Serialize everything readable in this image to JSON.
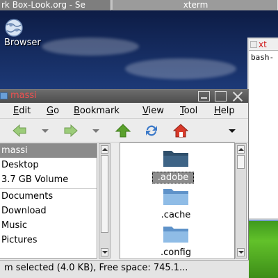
{
  "taskbar": {
    "tasks": [
      {
        "label": "rk Box-Look.org - Se",
        "active": true
      },
      {
        "label": "xterm",
        "active": false
      }
    ]
  },
  "desktop": {
    "icons": [
      {
        "label": "Browser",
        "icon": "globe-icon"
      }
    ]
  },
  "xterm": {
    "title": "xt",
    "line": "bash-"
  },
  "file_manager": {
    "title": "massi",
    "menu": [
      {
        "label": "Edit",
        "mnemonic": "E",
        "rest": "dit"
      },
      {
        "label": "Go",
        "mnemonic": "G",
        "rest": "o"
      },
      {
        "label": "Bookmark",
        "mnemonic": "B",
        "rest": "ookmark"
      },
      {
        "label": "View",
        "mnemonic": "V",
        "rest": "iew"
      },
      {
        "label": "Tool",
        "mnemonic": "T",
        "rest": "ool"
      },
      {
        "label": "Help",
        "mnemonic": "H",
        "rest": "elp"
      }
    ],
    "toolbar": {
      "back_icon": "back-arrow-icon",
      "forward_icon": "forward-arrow-icon",
      "up_icon": "up-arrow-icon",
      "reload_icon": "reload-icon",
      "home_icon": "home-icon"
    },
    "sidebar": {
      "items": [
        {
          "label": "massi",
          "selected": true
        },
        {
          "label": "Desktop",
          "selected": false
        },
        {
          "label": "3.7 GB Volume",
          "selected": false
        },
        {
          "label": "Documents",
          "selected": false
        },
        {
          "label": "Download",
          "selected": false
        },
        {
          "label": "Music",
          "selected": false
        },
        {
          "label": "Pictures",
          "selected": false
        }
      ]
    },
    "files": [
      {
        "name": ".adobe",
        "selected": true
      },
      {
        "name": ".cache",
        "selected": false
      },
      {
        "name": ".config",
        "selected": false
      }
    ],
    "status": "m selected (4.0 KB), Free space: 745.1..."
  },
  "colors": {
    "selection": "#8b8b8b",
    "folder": "#6fa3d9",
    "folder_dark": "#2f4f6b",
    "arrow_green": "#5aa02c",
    "home_red": "#d83a2a",
    "reload_blue": "#3a78c8"
  }
}
